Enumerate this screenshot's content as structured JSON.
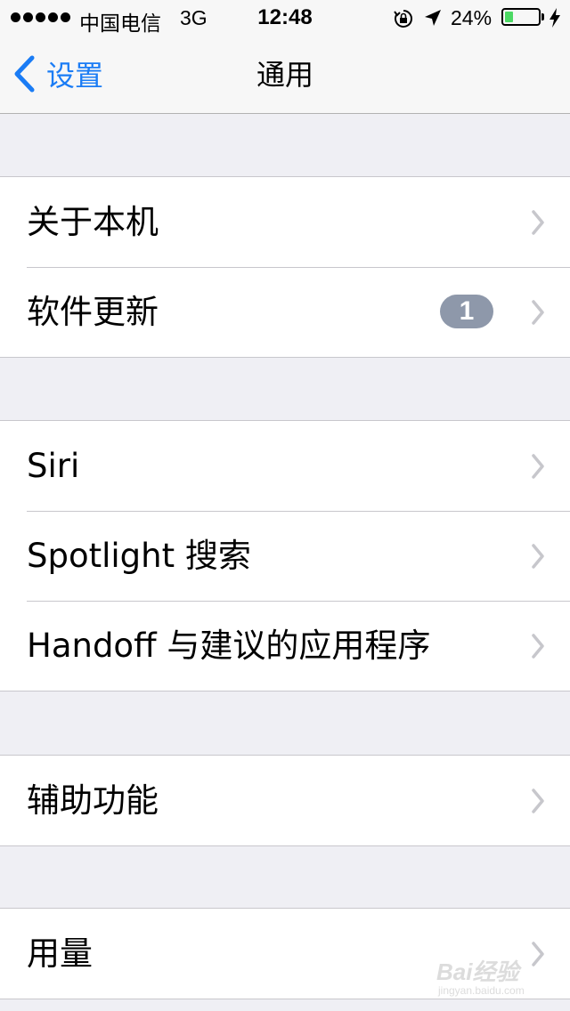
{
  "status_bar": {
    "carrier": "中国电信",
    "network": "3G",
    "time": "12:48",
    "battery": "24%",
    "battery_level": 0.24,
    "icons": [
      "signal-dots",
      "rotation-lock-icon",
      "location-arrow-icon",
      "battery-icon",
      "charging-bolt-icon"
    ]
  },
  "nav": {
    "back_label": "设置",
    "title": "通用"
  },
  "groups": [
    {
      "rows": [
        {
          "label": "关于本机"
        },
        {
          "label": "软件更新",
          "badge": "1"
        }
      ]
    },
    {
      "rows": [
        {
          "label": "Siri"
        },
        {
          "label": "Spotlight 搜索"
        },
        {
          "label": "Handoff 与建议的应用程序"
        }
      ]
    },
    {
      "rows": [
        {
          "label": "辅助功能"
        }
      ]
    },
    {
      "rows": [
        {
          "label": "用量"
        }
      ]
    }
  ],
  "watermark": {
    "text": "Bai经验",
    "sub": "jingyan.baidu.com"
  },
  "colors": {
    "accent": "#1a7cf5",
    "badge": "#8e98aa",
    "background": "#efeff4",
    "battery": "#4cd964"
  }
}
